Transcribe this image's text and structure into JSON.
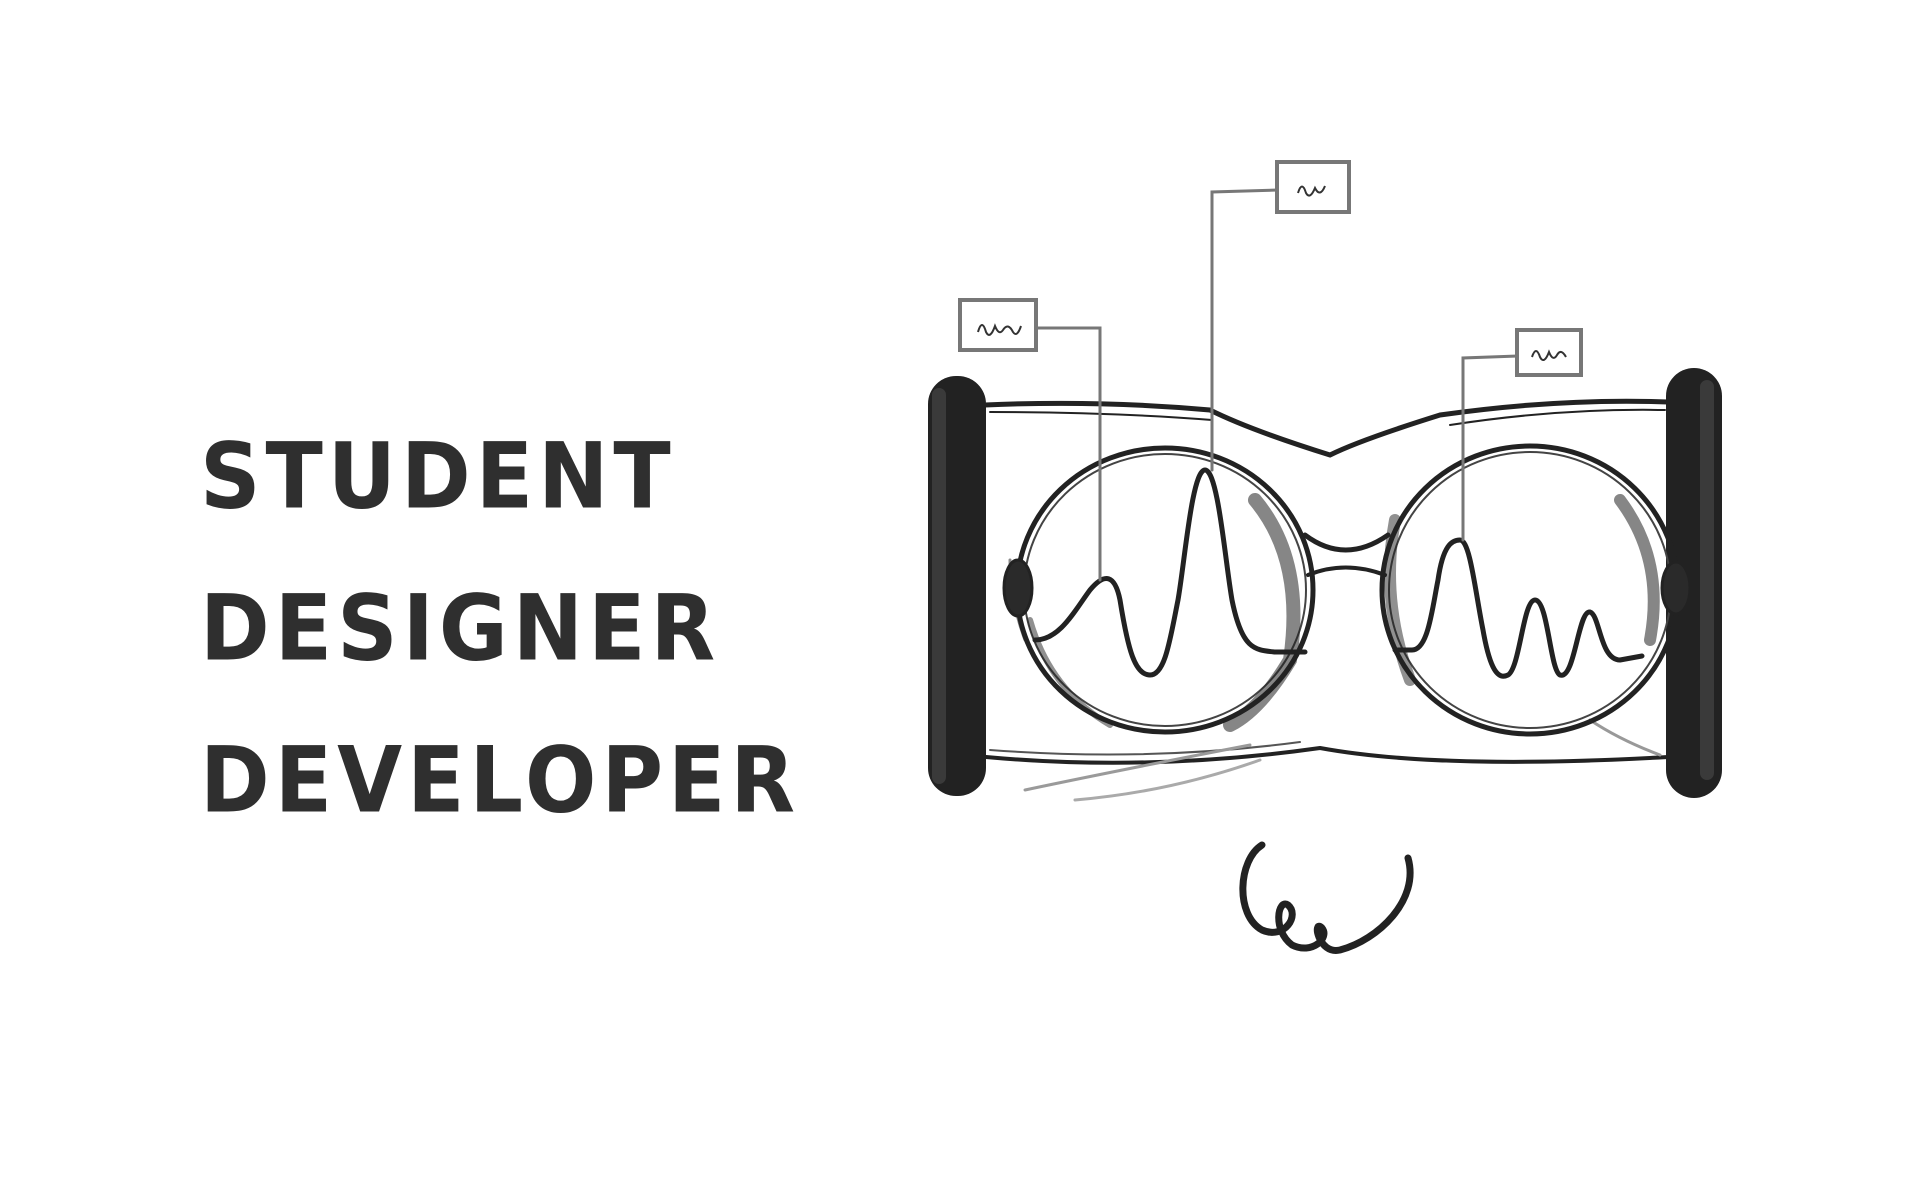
{
  "hero": {
    "roles": [
      "STUDENT",
      "DESIGNER",
      "DEVELOPER"
    ]
  },
  "illustration": {
    "description_icon": "sketched-glasses-with-waveform-lenses",
    "colors": {
      "ink": "#222222",
      "soft_ink": "#8a8a8a",
      "text": "#2f2f2f",
      "background": "#ffffff"
    }
  }
}
